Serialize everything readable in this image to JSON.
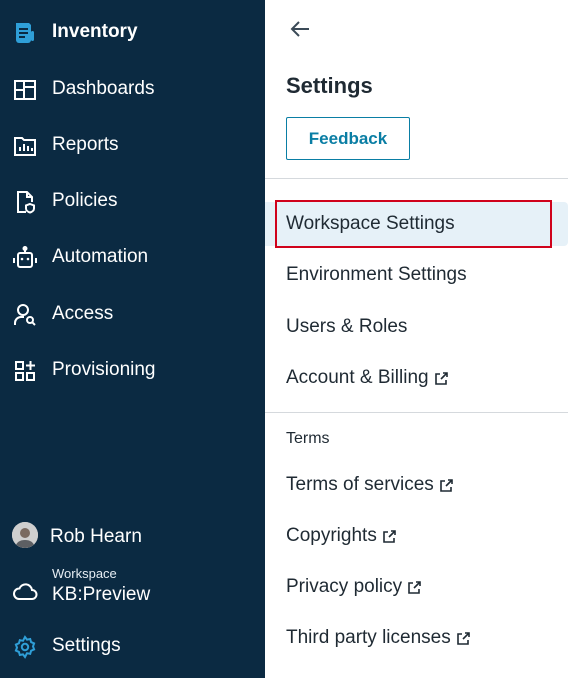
{
  "sidebar": {
    "brand": {
      "label": "Inventory",
      "icon": "inventory-doc-icon"
    },
    "items": [
      {
        "label": "Dashboards",
        "icon": "dashboard-grid-icon"
      },
      {
        "label": "Reports",
        "icon": "reports-chart-icon"
      },
      {
        "label": "Policies",
        "icon": "policy-doc-shield-icon"
      },
      {
        "label": "Automation",
        "icon": "robot-icon"
      },
      {
        "label": "Access",
        "icon": "user-search-icon"
      },
      {
        "label": "Provisioning",
        "icon": "provisioning-grid-plus-icon"
      }
    ],
    "user": {
      "name": "Rob Hearn",
      "icon": "avatar"
    },
    "workspace": {
      "caption": "Workspace",
      "value": "KB:Preview",
      "icon": "cloud-icon"
    },
    "settings": {
      "label": "Settings",
      "icon": "gear-icon",
      "accent": "#2f9fd8"
    },
    "background": "#0b2a42"
  },
  "panel": {
    "back_icon": "arrow-left-icon",
    "title": "Settings",
    "feedback_label": "Feedback",
    "accent": "#0a7ea4",
    "primary_items": [
      {
        "label": "Workspace Settings",
        "active": true,
        "external": false
      },
      {
        "label": "Environment Settings",
        "active": false,
        "external": false
      },
      {
        "label": "Users & Roles",
        "active": false,
        "external": false
      },
      {
        "label": "Account & Billing",
        "active": false,
        "external": true
      }
    ],
    "section_label": "Terms",
    "terms_items": [
      {
        "label": "Terms of services",
        "external": true
      },
      {
        "label": "Copyrights",
        "external": true
      },
      {
        "label": "Privacy policy",
        "external": true
      },
      {
        "label": "Third party licenses",
        "external": true
      }
    ],
    "highlight_color": "#d0021b"
  }
}
